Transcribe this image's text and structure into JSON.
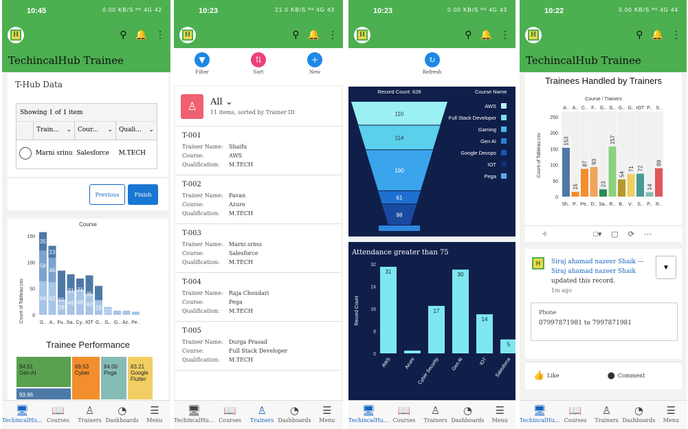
{
  "screens": [
    {
      "time": "10:45",
      "status_right": "0.00 KB/S ᴴᵈ 4G 42",
      "app_title": "TechincalHub  Trainee"
    },
    {
      "time": "10:23",
      "status_right": "21.0 KB/S ᴴᵈ 4G 43",
      "app_title": "TechincalHub  Trainee"
    },
    {
      "time": "10:23",
      "status_right": "0.00 KB/S ᴴᵈ 4G 43",
      "app_title": ""
    },
    {
      "time": "10:22",
      "status_right": "0.00 KB/S ᴴᵈ 4G 44",
      "app_title": "TechincalHub  Trainee"
    }
  ],
  "nav": [
    "TechincalHu...",
    "Courses",
    "Trainers",
    "Dashboards",
    "Menu"
  ],
  "s1": {
    "card_title": "T-Hub Data",
    "showing": "Showing 1 of 1 item",
    "cols": [
      "Train...",
      "Cour...",
      "Quali..."
    ],
    "row": [
      "Marni srinu",
      "Salesforce",
      "M.TECH"
    ],
    "prev": "Previous",
    "finish": "Finish",
    "chart_title": "Course",
    "ylabel": "Count of Tableau.csv",
    "perf_title": "Trainee Performance",
    "tiles": [
      {
        "v": "94.51",
        "l": "Gen AI"
      },
      {
        "v": "89.53",
        "l": "Cyber"
      },
      {
        "v": "84.00",
        "l": "Pega"
      },
      {
        "v": "83.21",
        "l": "Google Flutter"
      },
      {
        "v": "93.96",
        "l": ""
      }
    ]
  },
  "s2": {
    "filter": "Filter",
    "sort": "Sort",
    "new": "New",
    "all": "All",
    "sub": "11 items, sorted by Trainer ID",
    "lbl_name": "Trainer Name:",
    "lbl_course": "Course:",
    "lbl_qual": "Qualification:",
    "records": [
      {
        "id": "T-001",
        "name": "Shaifu",
        "course": "AWS",
        "qual": "M.TECH"
      },
      {
        "id": "T-002",
        "name": "Pavan",
        "course": "Azure",
        "qual": "M.TECH"
      },
      {
        "id": "T-003",
        "name": "Marni srinu",
        "course": "Salesforce",
        "qual": "M.TECH"
      },
      {
        "id": "T-004",
        "name": "Raja Choudari",
        "course": "Pega",
        "qual": "M.TECH"
      },
      {
        "id": "T-005",
        "name": "Durga Prasad",
        "course": "Full Stack Developer",
        "qual": "M.TECH"
      }
    ]
  },
  "s3": {
    "refresh": "Refresh",
    "record_count": "Record Count: 628",
    "legend_title": "Course Name",
    "legend": [
      {
        "n": "AWS",
        "c": "#b7f3f7"
      },
      {
        "n": "Full Stack Developer",
        "c": "#7fe0f0"
      },
      {
        "n": "Gaming",
        "c": "#4bb5f0"
      },
      {
        "n": "Gen AI",
        "c": "#2a7fd6"
      },
      {
        "n": "Google Devops",
        "c": "#1a57b0"
      },
      {
        "n": "IOT",
        "c": "#0f2f78"
      },
      {
        "n": "Pega",
        "c": "#5ca8e8"
      }
    ],
    "att_title": "Attendance greater than 75",
    "att_ylabel": "Record Count"
  },
  "s4": {
    "chart_title": "Trainees Handled by Trainers",
    "sub": "Course / Trainers",
    "ylabel": "Count of Tableau.csv",
    "post_name": "Siraj ahamad nazeer Shaik — Siraj ahamad nazeer Shaik",
    "post_action": " updated this record.",
    "post_time": "1m ago",
    "phone_label": "Phone",
    "phone_value": "07997871981 to 7997871981",
    "like": "Like",
    "comment": "Comment"
  },
  "chart_data": [
    {
      "type": "bar",
      "title": "Course",
      "ylabel": "Count of Tableau.csv",
      "ylim": [
        0,
        150
      ],
      "categories": [
        "G..",
        "A..",
        "Fu..",
        "Sa..",
        "Cy..",
        "IOT",
        "G..",
        "G..",
        "G..",
        "Az..",
        "Pe.."
      ],
      "series": [
        {
          "values": [
            64,
            62,
            29,
            46,
            48,
            40,
            28,
            15,
            8,
            8,
            6
          ]
        },
        {
          "values": [
            58,
            46,
            0,
            0,
            0,
            0,
            0,
            0,
            0,
            0,
            0
          ]
        },
        {
          "values": [
            35,
            23,
            55,
            31,
            21,
            35,
            27,
            0,
            0,
            0,
            0
          ]
        }
      ],
      "data_labels": [
        [
          "64",
          "58",
          "35"
        ],
        [
          "62",
          "46",
          "23"
        ],
        [
          "29",
          "55"
        ],
        [
          "46",
          "31"
        ],
        [
          "48",
          "21"
        ],
        [
          "40",
          "35"
        ],
        [
          "29"
        ],
        [
          "27"
        ],
        [],
        [],
        []
      ]
    },
    {
      "type": "funnel",
      "title": "Record Count: 628",
      "values": [
        110,
        114,
        190,
        61,
        98
      ]
    },
    {
      "type": "bar",
      "title": "Attendance greater than 75",
      "ylabel": "Record Count",
      "ylim": [
        0,
        32
      ],
      "categories": [
        "AWS",
        "Azure",
        "Cyber Security",
        "Gen AI",
        "IOT",
        "Salesforce"
      ],
      "values": [
        31,
        1,
        17,
        30,
        14,
        5
      ]
    },
    {
      "type": "bar",
      "title": "Trainees Handled by Trainers",
      "xlabel": "Course / Trainers",
      "ylabel": "Count of Tableau.csv",
      "ylim": [
        0,
        250
      ],
      "top_categories": [
        "A..",
        "A..",
        "C..",
        "F..",
        "G..",
        "G..",
        "G..",
        "G..",
        "IOT",
        "P..",
        "S.."
      ],
      "categories": [
        "Sh..",
        "P..",
        "Pe..",
        "D..",
        "Sa..",
        "R..",
        "B..",
        "V..",
        "S..",
        "P..",
        "R.."
      ],
      "values": [
        153,
        15,
        87,
        93,
        23,
        157,
        54,
        71,
        72,
        14,
        89
      ],
      "colors": [
        "#4e79a7",
        "#f28e2b",
        "#f28e2b",
        "#f1a35a",
        "#2e8b57",
        "#8cd17d",
        "#b6992d",
        "#f1ce63",
        "#499894",
        "#86bcb6",
        "#e15759"
      ]
    }
  ]
}
